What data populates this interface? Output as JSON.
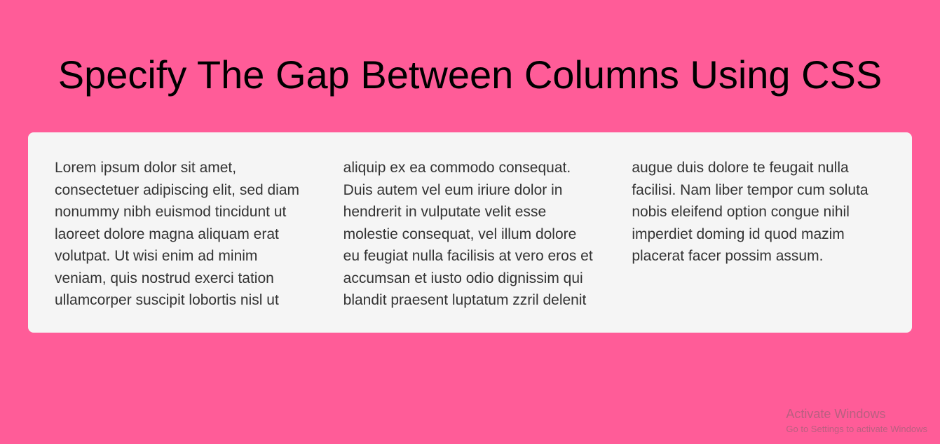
{
  "title": "Specify The Gap Between Columns Using CSS",
  "bodyText": "Lorem ipsum dolor sit amet, consectetuer adipiscing elit, sed diam nonummy nibh euismod tincidunt ut laoreet dolore magna aliquam erat volutpat. Ut wisi enim ad minim veniam, quis nostrud exerci tation ullamcorper suscipit lobortis nisl ut aliquip ex ea commodo consequat. Duis autem vel eum iriure dolor in hendrerit in vulputate velit esse molestie consequat, vel illum dolore eu feugiat nulla facilisis at vero eros et accumsan et iusto odio dignissim qui blandit praesent luptatum zzril delenit augue duis dolore te feugait nulla facilisi. Nam liber tempor cum soluta nobis eleifend option congue nihil imperdiet doming id quod mazim placerat facer possim assum.",
  "watermark": {
    "title": "Activate Windows",
    "subtitle": "Go to Settings to activate Windows"
  }
}
